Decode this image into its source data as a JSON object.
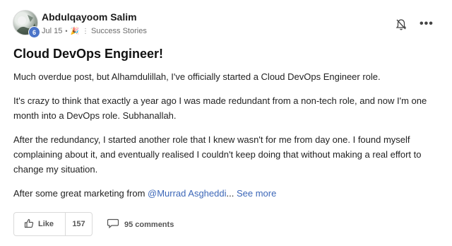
{
  "post": {
    "author": "Abdulqayoom Salim",
    "level": "6",
    "date": "Jul 15",
    "separator": "•",
    "category": "Success Stories",
    "title": "Cloud DevOps Engineer!",
    "paragraphs": [
      "Much overdue post, but Alhamdulillah, I've officially started a Cloud DevOps Engineer role.",
      "It's crazy to think that exactly a year ago I was made redundant from a non-tech role, and now I'm one month into a DevOps role. Subhanallah.",
      "After the redundancy, I started another role that I knew wasn't for me from day one. I found myself complaining about it, and eventually realised I couldn't keep doing that without making a real effort to change my situation."
    ],
    "last_line_prefix": "After some great marketing from ",
    "mention": "@Murrad Asgheddi",
    "ellipsis": "...",
    "see_more": "See more"
  },
  "actions": {
    "like_label": "Like",
    "like_count": "157",
    "comments_label": "95 comments",
    "more_label": "•••"
  },
  "icons": {
    "bell": "bell-off-icon",
    "like": "thumbs-up-icon",
    "comment": "comment-icon",
    "more": "more-horizontal-icon"
  },
  "colors": {
    "link": "#3c67b8",
    "badge": "#4a74c9"
  }
}
